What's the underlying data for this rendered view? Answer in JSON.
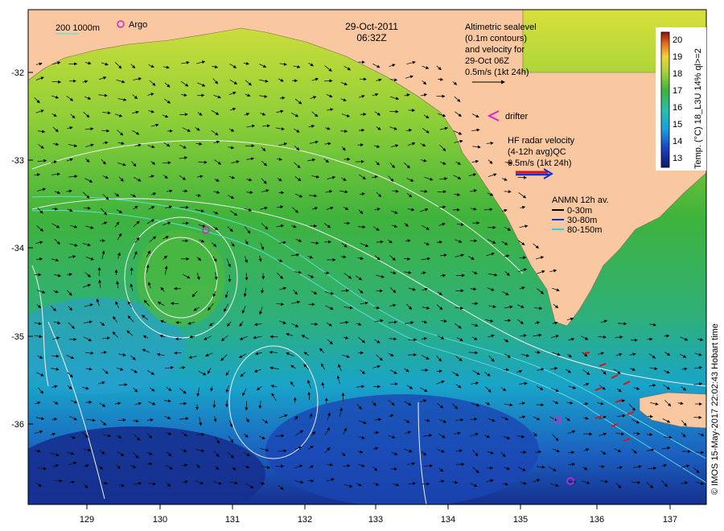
{
  "header": {
    "date": "29-Oct-2011",
    "time": "06:32Z"
  },
  "colors": {
    "land": "#f9c8a0",
    "coast_outline": "#7a6a55",
    "sst_warm": "#d7de3a",
    "sst_mid": "#3fb33c",
    "sst_cool": "#19a4c9",
    "sst_cold": "#1f3aa8",
    "contour": "#f2f2f2",
    "isobath_200": "#60e0e0",
    "argo": "#d426c9",
    "drifter": "#d426c9",
    "hf_radar": "#1030d0",
    "hf_radar_back": "#e01010",
    "anmn_0_30": "#000000",
    "anmn_30_80": "#0a2be0",
    "anmn_80_150": "#22d4e4"
  },
  "legend": {
    "bathymetry": "200  1000m",
    "argo": "Argo",
    "altimetry_lines": [
      "Altimetric sealevel",
      "(0.1m contours)",
      "and velocity for",
      "29-Oct 06Z",
      "0.5m/s (1kt 24h)"
    ],
    "drifter": "drifter",
    "hf_radar_lines": [
      "HF radar velocity",
      "(4-12h avg)QC",
      "0.5m/s (1kt 24h)"
    ],
    "anmn_title": "ANMN 12h av.",
    "anmn_items": [
      {
        "label": "0-30m",
        "color": "#000000"
      },
      {
        "label": "30-80m",
        "color": "#0a2be0"
      },
      {
        "label": "80-150m",
        "color": "#22d4e4"
      }
    ]
  },
  "colorbar": {
    "title": "Temp. (°C) 18_L3U 14% ql>=2",
    "ticks": [
      "13",
      "14",
      "15",
      "16",
      "17",
      "18",
      "19",
      "20"
    ]
  },
  "axes": {
    "longitude_ticks": [
      "129",
      "130",
      "131",
      "132",
      "133",
      "134",
      "135",
      "136",
      "137"
    ],
    "latitude_ticks": [
      "-32",
      "-33",
      "-34",
      "-35",
      "-36"
    ]
  },
  "credit": "© IMOS 15-May-2017 22:02:43 Hobart time"
}
